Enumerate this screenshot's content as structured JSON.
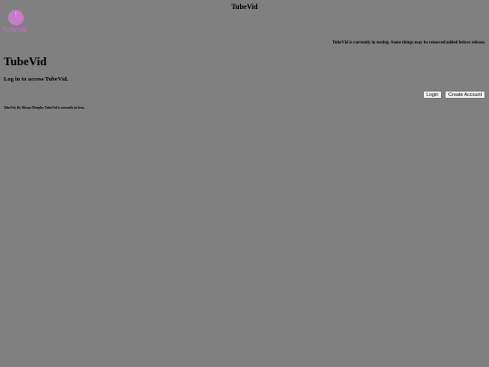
{
  "header": {
    "title": "TubeVid"
  },
  "logo": {
    "icon": "play-circle-icon",
    "glyph": "!",
    "text": "TubeVid",
    "color": "#c77bc8"
  },
  "notice": "TubeVid is currently in testing. Some things may be removed/added before release.",
  "main": {
    "heading": "TubeVid",
    "subheading": "Log in to access TubeVid."
  },
  "actions": {
    "login_label": "Login",
    "create_account_label": "Create Account"
  },
  "footer": {
    "text": "TubeVid, By Mason Murphy.  TubeVid is currently in beta."
  }
}
